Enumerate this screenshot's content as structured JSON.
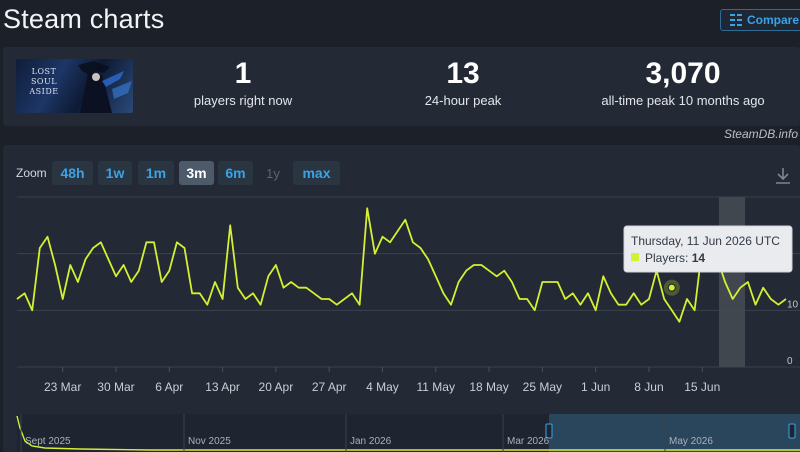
{
  "header": {
    "title": "Steam charts",
    "compare_label": "Compare"
  },
  "game": {
    "thumbnail_text": "LOST SOUL ASIDE"
  },
  "stats": [
    {
      "value": "1",
      "label": "players right now"
    },
    {
      "value": "13",
      "label": "24-hour peak"
    },
    {
      "value": "3,070",
      "label": "all-time peak 10 months ago"
    }
  ],
  "credit": "SteamDB.info",
  "zoom": {
    "label": "Zoom",
    "options": [
      {
        "label": "48h",
        "state": "normal"
      },
      {
        "label": "1w",
        "state": "normal"
      },
      {
        "label": "1m",
        "state": "normal"
      },
      {
        "label": "3m",
        "state": "active"
      },
      {
        "label": "6m",
        "state": "normal"
      },
      {
        "label": "1y",
        "state": "disabled"
      },
      {
        "label": "max",
        "state": "normal"
      }
    ]
  },
  "tooltip": {
    "date": "Thursday, 11 Jun 2026 UTC",
    "series_label": "Players: ",
    "value": "14"
  },
  "navigator": {
    "labels": [
      "Sept 2025",
      "Nov 2025",
      "Jan 2026",
      "Mar 2026",
      "May 2026"
    ]
  },
  "colors": {
    "line": "#d4f032",
    "accent": "#3aa3e6",
    "background": "#1b2029",
    "panel": "#232935"
  },
  "chart_data": {
    "type": "line",
    "title": "",
    "xlabel": "",
    "ylabel": "",
    "x_tick_labels": [
      "23 Mar",
      "30 Mar",
      "6 Apr",
      "13 Apr",
      "20 Apr",
      "27 Apr",
      "4 May",
      "11 May",
      "18 May",
      "25 May",
      "1 Jun",
      "8 Jun",
      "15 Jun"
    ],
    "y_tick_labels": [
      "0",
      "10"
    ],
    "ylim": [
      0,
      30
    ],
    "grid": true,
    "legend": "none",
    "series": [
      {
        "name": "Players",
        "x_start": "17 Mar",
        "interval_days": 1,
        "values": [
          12,
          13,
          10,
          21,
          23,
          18,
          12,
          18,
          15,
          19,
          21,
          22,
          19,
          16,
          18,
          15,
          17,
          22,
          22,
          15,
          17,
          22,
          21,
          13,
          13,
          11,
          15,
          12,
          25,
          14,
          12,
          13,
          11,
          16,
          18,
          14,
          15,
          14,
          14,
          13,
          12,
          12,
          11,
          12,
          13,
          11,
          28,
          20,
          23,
          22,
          24,
          26,
          22,
          21,
          19,
          16,
          13,
          11,
          15,
          17,
          18,
          18,
          17,
          16,
          17,
          15,
          12,
          12,
          10,
          15,
          15,
          15,
          12,
          13,
          11,
          13,
          10,
          16,
          13,
          11,
          11,
          13,
          11,
          12,
          17,
          12,
          10,
          8,
          12,
          10,
          21,
          21,
          19,
          15,
          12,
          14,
          15,
          11,
          14,
          12,
          11,
          12
        ]
      }
    ],
    "tooltip_point": {
      "x": "11 Jun",
      "y": 14
    }
  }
}
